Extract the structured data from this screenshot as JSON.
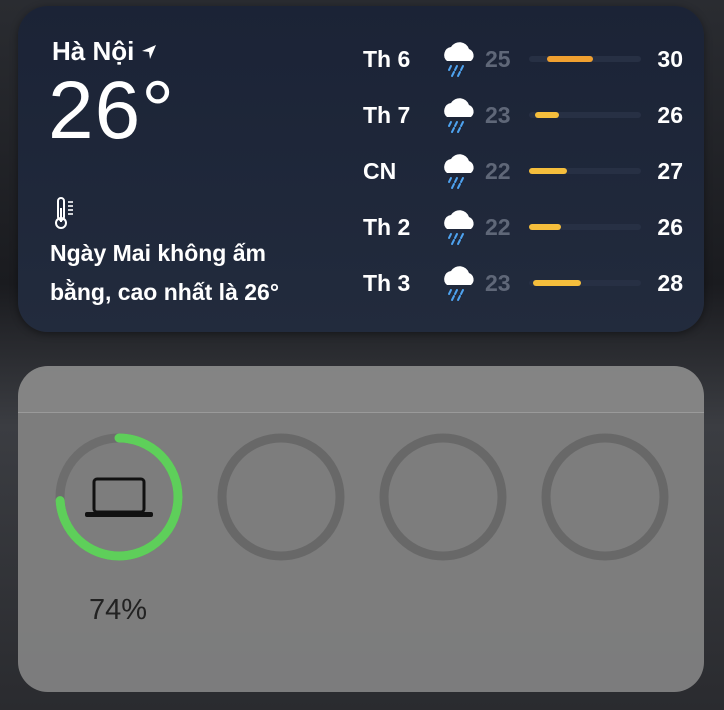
{
  "weather": {
    "city": "Hà Nội",
    "location_icon": "location-arrow-icon",
    "temperature": "26°",
    "condition_icon": "thermometer-icon",
    "description_line1": "Ngày Mai không ấm",
    "description_line2": "bằng, cao nhất là 26°",
    "forecast": [
      {
        "day": "Th 6",
        "icon": "rain-cloud-icon",
        "low": "25",
        "high": "30",
        "bar_color": "#f0a030"
      },
      {
        "day": "Th 7",
        "icon": "rain-cloud-icon",
        "low": "23",
        "high": "26",
        "bar_color": "#f5be3c"
      },
      {
        "day": "CN",
        "icon": "rain-cloud-icon",
        "low": "22",
        "high": "27",
        "bar_color": "#f5be3c"
      },
      {
        "day": "Th 2",
        "icon": "rain-cloud-icon",
        "low": "22",
        "high": "26",
        "bar_color": "#f5be3c"
      },
      {
        "day": "Th 3",
        "icon": "rain-cloud-icon",
        "low": "23",
        "high": "28",
        "bar_color": "#f5be3c"
      }
    ]
  },
  "batteries": {
    "devices": [
      {
        "icon": "laptop-icon",
        "percent": "74%",
        "level": 0.74,
        "ring_color": "#5ecf5a"
      },
      {
        "icon": "",
        "percent": "",
        "level": 0
      },
      {
        "icon": "",
        "percent": "",
        "level": 0
      },
      {
        "icon": "",
        "percent": "",
        "level": 0
      }
    ]
  }
}
